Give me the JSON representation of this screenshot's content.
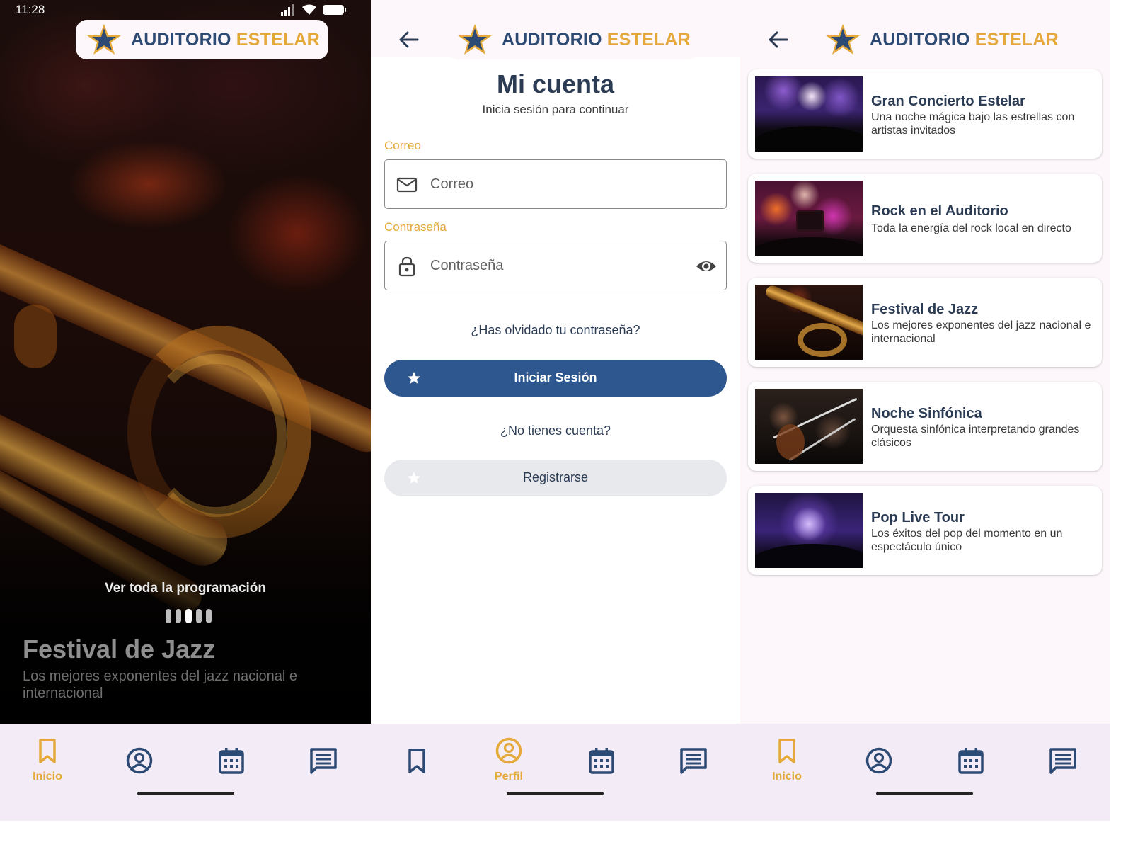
{
  "status_bar": {
    "time": "11:28"
  },
  "brand": {
    "word1": "AUDITORIO",
    "word2": "ESTELAR",
    "accent": "#e4a93a",
    "primary": "#2c4a73"
  },
  "home": {
    "see_all": "Ver toda la programación",
    "carousel": {
      "count": 5,
      "active_index": 2
    },
    "featured_title": "Festival de Jazz",
    "featured_subtitle": "Los mejores exponentes del jazz nacional e internacional"
  },
  "login": {
    "title": "Mi cuenta",
    "subtitle": "Inicia sesión para continuar",
    "email_label": "Correo",
    "email_placeholder": "Correo",
    "password_label": "Contraseña",
    "password_placeholder": "Contraseña",
    "forgot_link": "¿Has olvidado tu contraseña?",
    "login_button": "Iniciar Sesión",
    "no_account": "¿No tienes cuenta?",
    "register_button": "Registrarse"
  },
  "events": [
    {
      "title": "Gran Concierto Estelar",
      "description": "Una noche mágica bajo las estrellas con artistas invitados",
      "image": "concert-crowd"
    },
    {
      "title": "Rock en el Auditorio",
      "description": "Toda la energía del rock local en directo",
      "image": "rock-concert"
    },
    {
      "title": "Festival de Jazz",
      "description": "Los mejores exponentes del jazz nacional e internacional",
      "image": "trumpet"
    },
    {
      "title": "Noche Sinfónica",
      "description": "Orquesta sinfónica interpretando grandes clásicos",
      "image": "violins"
    },
    {
      "title": "Pop Live Tour",
      "description": "Los éxitos del pop del momento en un espectáculo único",
      "image": "pop-stage"
    }
  ],
  "nav": {
    "home_label": "Inicio",
    "profile_label": "Perfil",
    "icons": [
      "bookmark-icon",
      "account-circle-icon",
      "calendar-icon",
      "message-icon"
    ]
  }
}
